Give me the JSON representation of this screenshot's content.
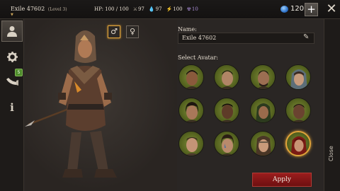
{
  "player": {
    "name": "Exile 47602",
    "level": "(Level 3)",
    "flag": "▼"
  },
  "stats": {
    "hp": "HP: 100 / 100",
    "attack": "97",
    "water": "97",
    "energy": "100",
    "radiation": "10"
  },
  "currency": {
    "amount": "120"
  },
  "buttons": {
    "plus": "+",
    "close_x": "✕",
    "apply": "Apply",
    "close": "Close"
  },
  "sidebar": {
    "items": [
      {
        "icon": "person-icon",
        "glyph": "👤"
      },
      {
        "icon": "gear-icon",
        "glyph": "⚙"
      },
      {
        "icon": "horn-icon",
        "glyph": "📯",
        "badge": "5"
      },
      {
        "icon": "info-icon",
        "glyph": "i"
      }
    ]
  },
  "gender": {
    "male": "♂",
    "female": "♀"
  },
  "name_form": {
    "label": "Name:",
    "value": "Exile 47602",
    "edit_icon": "pencil-icon"
  },
  "avatar_section": {
    "label": "Select Avatar:",
    "selected_index": 11
  },
  "colors": {
    "accent": "#e0a33a",
    "apply": "#8a1616",
    "avatar_bg": "#6a7a2a"
  }
}
